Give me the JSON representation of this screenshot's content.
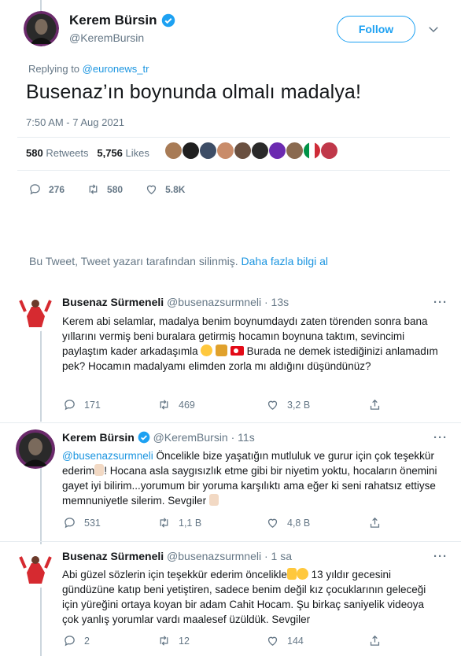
{
  "main_tweet": {
    "author_name": "Kerem Bürsin",
    "author_handle": "@KeremBursin",
    "follow_label": "Follow",
    "replying_prefix": "Replying to",
    "replying_to": "@euronews_tr",
    "text": "Busenaz’ın boynunda olmalı madalya!",
    "timestamp": "7:50 AM - 7 Aug 2021",
    "retweets_count": "580",
    "retweets_label": "Retweets",
    "likes_count": "5,756",
    "likes_label": "Likes",
    "reply_count": "276",
    "retweet_count": "580",
    "like_count": "5.8K"
  },
  "deleted_notice": {
    "text": "Bu Tweet, Tweet yazarı tarafından silinmiş.",
    "link": "Daha fazla bilgi al"
  },
  "replies": [
    {
      "name": "Busenaz Sürmeneli",
      "handle": "@busenazsurmneli · 13s",
      "text": "Kerem abi selamlar, madalya benim boynumdaydı zaten törenden sonra bana yıllarını vermiş beni buralara getirmiş hocamın boynuna taktım, sevincimi paylaştım kader arkadaşımla",
      "text_after": "Burada ne demek istediğinizi anlamadım pek? Hocamın madalyamı elimden zorla mı aldığını düşündünüz?",
      "reply_count": "171",
      "retweet_count": "469",
      "like_count": "3,2 B"
    },
    {
      "name": "Kerem Bürsin",
      "handle": "@KeremBursin · 11s",
      "mention": "@busenazsurmneli",
      "text": "Öncelikle bize yaşatığın mutluluk ve gurur için çok teşekkür ederim",
      "text_after": "! Hocana asla saygısızlık etme gibi bir niyetim yoktu, hocaların önemini gayet iyi bilirim...yorumum bir yoruma karşılıktı ama eğer ki seni rahatsız ettiyse memnuniyetle silerim. Sevgiler",
      "reply_count": "531",
      "retweet_count": "1,1 B",
      "like_count": "4,8 B"
    },
    {
      "name": "Busenaz Sürmeneli",
      "handle": "@busenazsurmneli · 1 sa",
      "text": "Abi güzel sözlerin için teşekkür ederim öncelikle",
      "text_after": "13 yıldır gecesini gündüzüne katıp beni yetiştiren, sadece benim değil kız çocuklarının geleceği için yüreğini ortaya koyan bir adam Cahit Hocam. Şu birkaç saniyelik videoya çok yanlış yorumlar vardı maalesef üzüldük. Sevgiler",
      "reply_count": "2",
      "retweet_count": "12",
      "like_count": "144"
    }
  ],
  "colors": {
    "accent": "#1da1f2",
    "muted": "#657786",
    "text": "#14171a",
    "divider": "#e6ecf0"
  },
  "icons": [
    "verified-badge-icon",
    "chevron-down-icon",
    "reply-icon",
    "retweet-icon",
    "like-icon",
    "share-icon",
    "more-icon"
  ]
}
